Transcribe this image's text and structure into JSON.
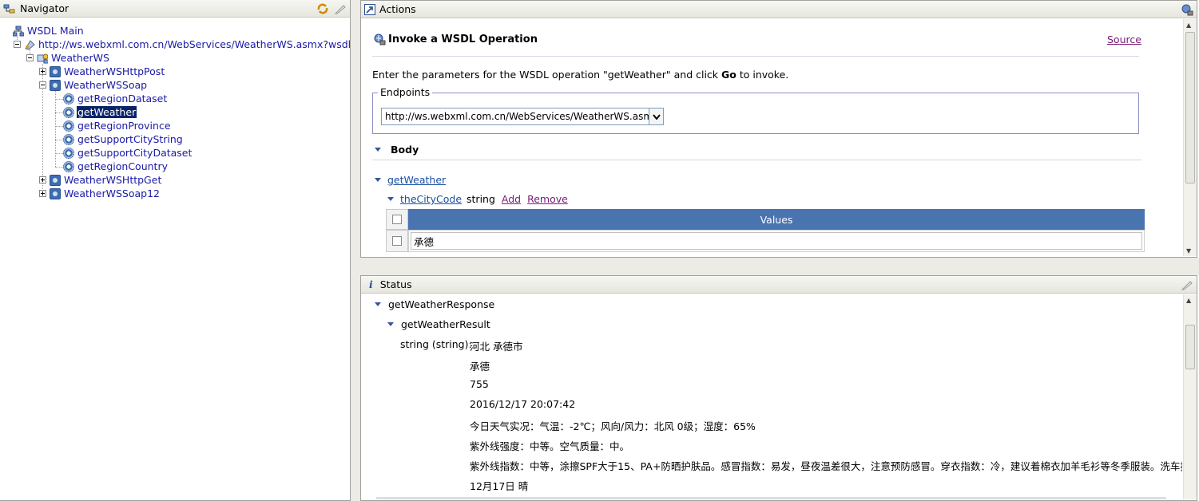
{
  "navigator": {
    "title": "Navigator",
    "tree": [
      {
        "label": "WSDL Main",
        "icon": "wsdl-main-icon"
      },
      {
        "label": "http://ws.webxml.com.cn/WebServices/WeatherWS.asmx?wsdl",
        "icon": "wsdl-file-icon"
      },
      {
        "label": "WeatherWS",
        "icon": "service-icon"
      },
      {
        "label": "WeatherWSHttpPost",
        "icon": "binding-icon"
      },
      {
        "label": "WeatherWSSoap",
        "icon": "binding-icon"
      },
      {
        "label": "getRegionDataset",
        "icon": "operation-icon"
      },
      {
        "label": "getWeather",
        "icon": "operation-icon",
        "selected": true
      },
      {
        "label": "getRegionProvince",
        "icon": "operation-icon"
      },
      {
        "label": "getSupportCityString",
        "icon": "operation-icon"
      },
      {
        "label": "getSupportCityDataset",
        "icon": "operation-icon"
      },
      {
        "label": "getRegionCountry",
        "icon": "operation-icon"
      },
      {
        "label": "WeatherWSHttpGet",
        "icon": "binding-icon"
      },
      {
        "label": "WeatherWSSoap12",
        "icon": "binding-icon"
      }
    ]
  },
  "actions": {
    "title": "Actions",
    "operation_title": "Invoke a WSDL Operation",
    "source_link": "Source",
    "instruction_pre": "Enter the parameters for the WSDL operation \"getWeather\" and click ",
    "instruction_go": "Go",
    "instruction_post": " to invoke.",
    "endpoints_legend": "Endpoints",
    "endpoint_value": "http://ws.webxml.com.cn/WebServices/WeatherWS.asmx",
    "body_label": "Body",
    "operation_link": "getWeather",
    "param_name": "theCityCode",
    "param_type": "string",
    "add_link": "Add",
    "remove_link": "Remove",
    "values_header": "Values",
    "value_input": "承德"
  },
  "status": {
    "title": "Status",
    "response": "getWeatherResponse",
    "result": "getWeatherResult",
    "string_label": "string (string):",
    "lines": [
      "河北 承德市",
      "承德",
      "755",
      "2016/12/17 20:07:42",
      "今日天气实况：气温：-2℃；风向/风力：北风 0级；湿度：65%",
      "紫外线强度：中等。空气质量：中。",
      "紫外线指数：中等，涂擦SPF大于15、PA+防晒护肤品。感冒指数：易发，昼夜温差很大，注意预防感冒。穿衣指数：冷，建议着棉衣加羊毛衫等冬季服装。洗车指数：较",
      "12月17日 晴"
    ]
  }
}
